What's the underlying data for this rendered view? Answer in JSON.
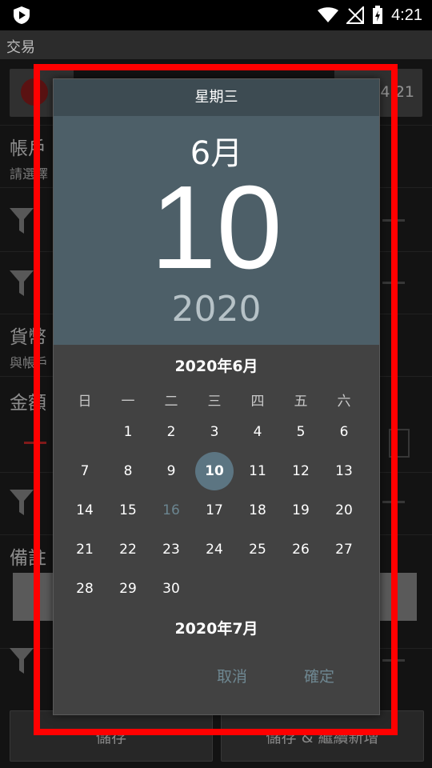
{
  "status": {
    "time": "4:21"
  },
  "appbar": {
    "title": "交易"
  },
  "background": {
    "top_right_value": "4:21",
    "account_label": "帳戶",
    "account_sub": "請選擇",
    "currency_label": "貨幣",
    "currency_sub": "與帳戶",
    "amount_label": "金額",
    "note_label": "備註",
    "save_label": "儲存",
    "save_continue_label": "儲存 & 繼續新增"
  },
  "dialog": {
    "weekday": "星期三",
    "month": "6月",
    "day": "10",
    "year": "2020",
    "calendar_month": "2020年6月",
    "next_month": "2020年7月",
    "weekday_headers": [
      "日",
      "一",
      "二",
      "三",
      "四",
      "五",
      "六"
    ],
    "weeks": [
      [
        "",
        "1",
        "2",
        "3",
        "4",
        "5",
        "6"
      ],
      [
        "7",
        "8",
        "9",
        "10",
        "11",
        "12",
        "13"
      ],
      [
        "14",
        "15",
        "16",
        "17",
        "18",
        "19",
        "20"
      ],
      [
        "21",
        "22",
        "23",
        "24",
        "25",
        "26",
        "27"
      ],
      [
        "28",
        "29",
        "30",
        "",
        "",
        "",
        ""
      ]
    ],
    "selected_day": "10",
    "today_day": "16",
    "cancel_label": "取消",
    "ok_label": "確定"
  },
  "colors": {
    "header_bg": "#4d5f68",
    "weekday_bg": "#3d4b52",
    "selected_circle": "#5c7582",
    "highlight_frame": "#ff0000"
  }
}
